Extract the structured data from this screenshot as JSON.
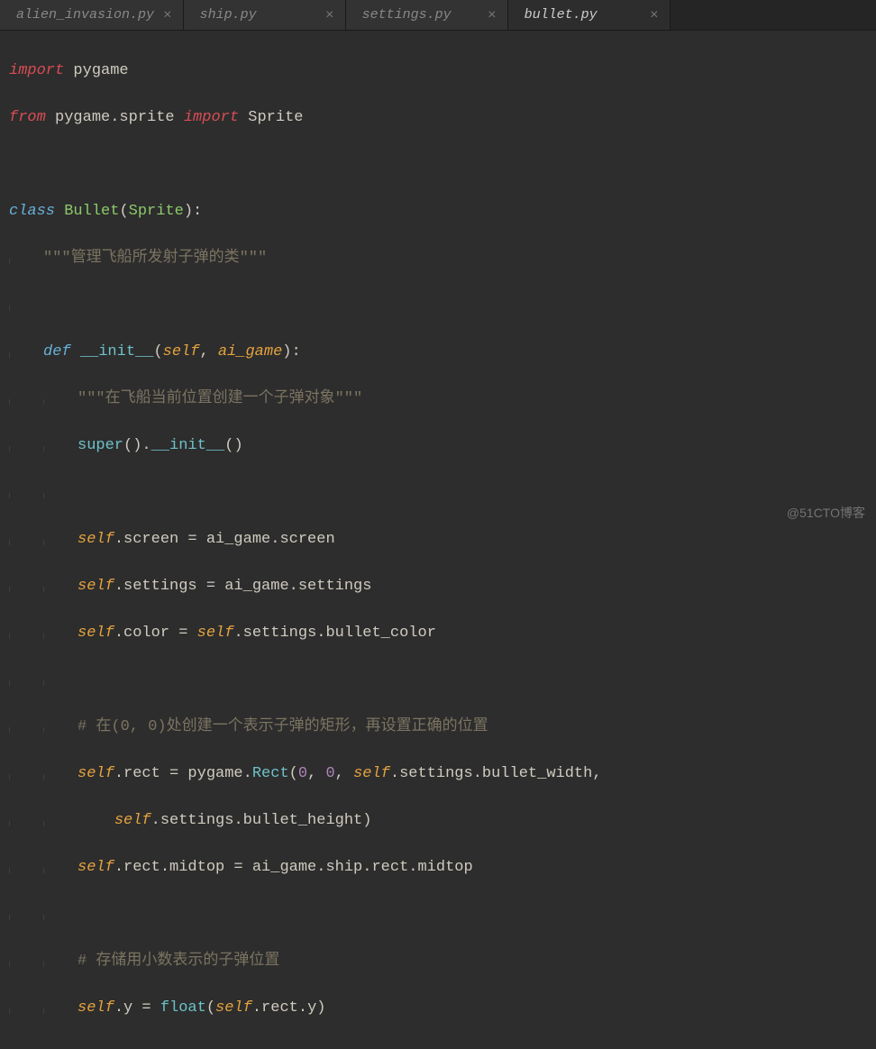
{
  "tabs": [
    {
      "label": "alien_invasion.py",
      "active": false
    },
    {
      "label": "ship.py",
      "active": false
    },
    {
      "label": "settings.py",
      "active": false
    },
    {
      "label": "bullet.py",
      "active": true
    }
  ],
  "code": {
    "l1_import": "import",
    "l1_pygame": "pygame",
    "l2_from": "from",
    "l2_mod": "pygame.sprite",
    "l2_import": "import",
    "l2_name": "Sprite",
    "l4_class": "class",
    "l4_name": "Bullet",
    "l4_base": "Sprite",
    "l5_doc": "\"\"\"管理飞船所发射子弹的类\"\"\"",
    "l7_def": "def",
    "l7_fn": "__init__",
    "l7_p1": "self",
    "l7_p2": "ai_game",
    "l8_doc": "\"\"\"在飞船当前位置创建一个子弹对象\"\"\"",
    "l9_super": "super",
    "l9_init": "__init__",
    "l11_self": "self",
    "l11_attr": ".screen = ai_game.screen",
    "l12_self": "self",
    "l12_attr": ".settings = ai_game.settings",
    "l13_self": "self",
    "l13_a": ".color = ",
    "l13_self2": "self",
    "l13_b": ".settings.bullet_color",
    "l15_comment": "# 在(0, 0)处创建一个表示子弹的矩形，再设置正确的位置",
    "l16_self": "self",
    "l16_a": ".rect = pygame.",
    "l16_rect": "Rect",
    "l16_z1": "0",
    "l16_z2": "0",
    "l16_self2": "self",
    "l16_b": ".settings.bullet_width,",
    "l17_self": "self",
    "l17_a": ".settings.bullet_height)",
    "l18_self": "self",
    "l18_a": ".rect.midtop = ai_game.ship.rect.midtop",
    "l20_comment": "# 存储用小数表示的子弹位置",
    "l21_self": "self",
    "l21_a": ".y = ",
    "l21_float": "float",
    "l21_self2": "self",
    "l21_b": ".rect.y)"
  },
  "watermark": "@51CTO博客"
}
